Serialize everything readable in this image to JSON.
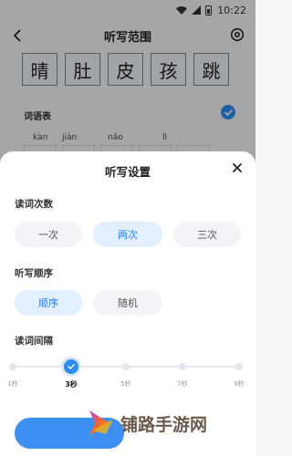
{
  "status_bar": {
    "time": "10:22"
  },
  "header": {
    "title": "听写范围"
  },
  "characters": [
    "晴",
    "肚",
    "皮",
    "孩",
    "跳"
  ],
  "word_list": {
    "label": "词语表",
    "pinyin": [
      "kàn",
      "jiàn",
      "nǎo",
      "lì"
    ]
  },
  "sheet": {
    "title": "听写设置",
    "read_count": {
      "label": "读词次数",
      "options": [
        "一次",
        "两次",
        "三次"
      ],
      "selected": "两次"
    },
    "order": {
      "label": "听写顺序",
      "options": [
        "顺序",
        "随机"
      ],
      "selected": "顺序"
    },
    "interval": {
      "label": "读词间隔",
      "ticks": [
        "1秒",
        "3秒",
        "5秒",
        "7秒",
        "9秒"
      ],
      "selected": "3秒"
    }
  },
  "watermark": {
    "text": "铺路手游网"
  },
  "colors": {
    "accent": "#2d8cf0",
    "selected_bg": "#e2efff",
    "watermark": "#6c5a4c"
  }
}
